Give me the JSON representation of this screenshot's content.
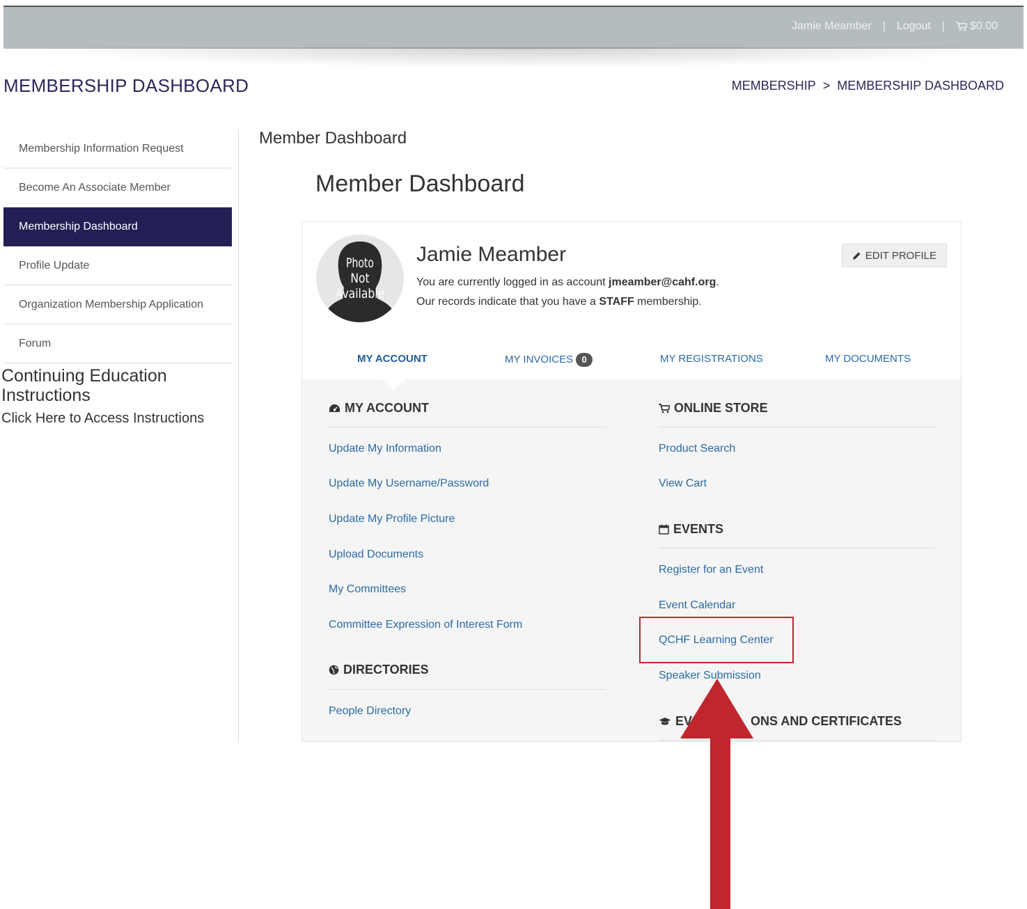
{
  "header": {
    "user_name": "Jamie Meamber",
    "logout": "Logout",
    "separator": "|",
    "cart_total": "$0.00"
  },
  "page": {
    "title": "MEMBERSHIP DASHBOARD",
    "breadcrumb": {
      "parent": "MEMBERSHIP",
      "separator": ">",
      "current": "MEMBERSHIP DASHBOARD"
    }
  },
  "sidebar": {
    "items": [
      {
        "label": "Membership Information Request"
      },
      {
        "label": "Become An Associate Member"
      },
      {
        "label": "Membership Dashboard"
      },
      {
        "label": "Profile Update"
      },
      {
        "label": "Organization Membership Application"
      },
      {
        "label": "Forum"
      }
    ],
    "active_index": 2,
    "ce_title": "Continuing Education Instructions",
    "ce_link": "Click Here to Access Instructions"
  },
  "main": {
    "small_title": "Member Dashboard",
    "big_title": "Member Dashboard"
  },
  "profile": {
    "avatar_text": [
      "Photo",
      "Not",
      "Available"
    ],
    "name": "Jamie Meamber",
    "acct_prefix": "You are currently logged in as account ",
    "acct_email": "jmeamber@cahf.org",
    "acct_suffix": ".",
    "memb_prefix": "Our records indicate that you have a ",
    "memb_type": "STAFF",
    "memb_suffix": " membership.",
    "edit_button": "EDIT PROFILE"
  },
  "tabs": [
    {
      "label": "MY ACCOUNT",
      "active": true
    },
    {
      "label": "MY INVOICES",
      "badge": "0"
    },
    {
      "label": "MY REGISTRATIONS"
    },
    {
      "label": "MY DOCUMENTS"
    }
  ],
  "sections": {
    "my_account": {
      "heading": "MY ACCOUNT",
      "links": [
        "Update My Information",
        "Update My Username/Password",
        "Update My Profile Picture",
        "Upload Documents",
        "My Committees",
        "Committee Expression of Interest Form"
      ]
    },
    "directories": {
      "heading": "DIRECTORIES",
      "links": [
        "People Directory"
      ]
    },
    "online_store": {
      "heading": "ONLINE STORE",
      "links": [
        "Product Search",
        "View Cart"
      ]
    },
    "events": {
      "heading": "EVENTS",
      "links": [
        "Register for an Event",
        "Event Calendar",
        "QCHF Learning Center",
        "Speaker Submission"
      ]
    },
    "evaluations": {
      "heading_left": "EV",
      "heading_right": "ONS AND CERTIFICATES"
    }
  },
  "annotation": {
    "highlight_color": "#c0262d",
    "arrow_color": "#c0262d"
  }
}
